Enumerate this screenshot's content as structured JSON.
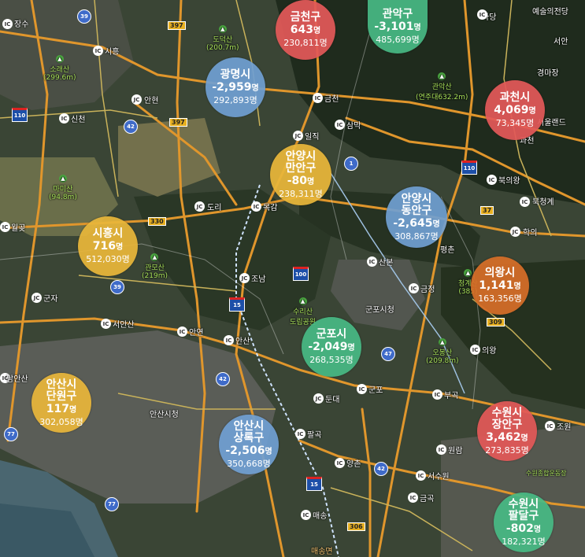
{
  "regions": [
    {
      "id": "geumcheon",
      "name1": "금천구",
      "name2": "",
      "change": "643",
      "change_suffix": "명",
      "population": "230,811명",
      "color": "red"
    },
    {
      "id": "gwanak",
      "name1": "관악구",
      "name2": "",
      "change": "-3,101",
      "change_suffix": "명",
      "population": "485,699명",
      "color": "green"
    },
    {
      "id": "gwangmyeong",
      "name1": "광명시",
      "name2": "",
      "change": "-2,959",
      "change_suffix": "명",
      "population": "292,893명",
      "color": "blue"
    },
    {
      "id": "gwacheon",
      "name1": "과천시",
      "name2": "",
      "change": "4,069",
      "change_suffix": "명",
      "population": "73,345명",
      "color": "red"
    },
    {
      "id": "anyang-manan",
      "name1": "안양시",
      "name2": "만안구",
      "change": "-80",
      "change_suffix": "명",
      "population": "238,311명",
      "color": "yellow"
    },
    {
      "id": "anyang-dongan",
      "name1": "안양시",
      "name2": "동안구",
      "change": "-2,645",
      "change_suffix": "명",
      "population": "308,867명",
      "color": "blue"
    },
    {
      "id": "siheung",
      "name1": "시흥시",
      "name2": "",
      "change": "716",
      "change_suffix": "명",
      "population": "512,030명",
      "color": "yellow"
    },
    {
      "id": "uiwang",
      "name1": "의왕시",
      "name2": "",
      "change": "1,141",
      "change_suffix": "명",
      "population": "163,356명",
      "color": "orange"
    },
    {
      "id": "gunpo",
      "name1": "군포시",
      "name2": "",
      "change": "-2,049",
      "change_suffix": "명",
      "population": "268,535명",
      "color": "green"
    },
    {
      "id": "ansan-danwon",
      "name1": "안산시",
      "name2": "단원구",
      "change": "117",
      "change_suffix": "명",
      "population": "302,058명",
      "color": "yellow"
    },
    {
      "id": "ansan-sangrok",
      "name1": "안산시",
      "name2": "상록구",
      "change": "-2,506",
      "change_suffix": "명",
      "population": "350,668명",
      "color": "blue"
    },
    {
      "id": "suwon-jangan",
      "name1": "수원시",
      "name2": "장안구",
      "change": "3,462",
      "change_suffix": "명",
      "population": "273,835명",
      "color": "red"
    },
    {
      "id": "suwon-paldal",
      "name1": "수원시",
      "name2": "팔달구",
      "change": "-802",
      "change_suffix": "명",
      "population": "182,321명",
      "color": "green"
    }
  ],
  "labels": {
    "jangsu": "장수",
    "siheung_ic": "시흥",
    "anhyeon": "안현",
    "sincheon": "신천",
    "geumcheon_ic": "금천",
    "samak": "삼막",
    "ilji": "일직",
    "seokam": "석암",
    "doeri": "도리",
    "mokgam": "목감",
    "joam": "조남",
    "hakui": "학의",
    "bukcheonggye": "북청계",
    "gwacheon_ic": "과천",
    "bugurui": "북의왕",
    "wolgot": "월곶",
    "gunja": "군자",
    "seoansan": "서안산",
    "anyeon": "안연",
    "ansan": "안산",
    "namansan": "남안산",
    "gunpo": "군포",
    "dundae": "둔대",
    "bugok": "부곡",
    "uiwang": "의왕",
    "paljang": "팔곡",
    "maesong": "매송",
    "yangchon": "양촌",
    "seosuwon": "서수원",
    "geumgok": "금곡",
    "wonram": "원람",
    "jowon": "조원",
    "sanbon": "산본",
    "pyeongchon": "평촌",
    "geumjeong": "금정",
    "gunposicheong": "군포시청",
    "ansansicheong": "안산시청",
    "sadang": "사당",
    "seoan": "서안",
    "yesuljeondang": "예술의전당",
    "hongeuntu": "송",
    "maesongmyeon": "매송면",
    "gwacheon_dong": "과천"
  },
  "mountains": [
    {
      "id": "dodeoksan",
      "name": "도덕산",
      "elev": "(200.7m)"
    },
    {
      "id": "sorae",
      "name": "소래산",
      "elev": "(299.6m)"
    },
    {
      "id": "gwanaksan",
      "name": "관악산",
      "elev": "(연주대632.2m)"
    },
    {
      "id": "magisan",
      "name": "마미산",
      "elev": "(94.8m)"
    },
    {
      "id": "gwanmosan",
      "name": "관모산",
      "elev": "(219m)"
    },
    {
      "id": "surisan",
      "name": "수리산",
      "elev": "도립공원"
    },
    {
      "id": "obongsan",
      "name": "오봉산",
      "elev": "(209.8m)"
    },
    {
      "id": "cheonggyesan",
      "name": "청계산",
      "elev": "(385)"
    }
  ],
  "pois": {
    "seoulland": "서울랜드",
    "gyeongmajang": "경마장",
    "suwonsports": "수원종합운동장"
  },
  "route_numbers": {
    "r397a": "397",
    "r397b": "397",
    "r330": "330",
    "r309": "309",
    "r306": "306",
    "r37": "37",
    "r39a": "39",
    "r39b": "39",
    "r42a": "42",
    "r42b": "42",
    "r42c": "42",
    "r47": "47",
    "r77a": "77",
    "r77b": "77",
    "r1": "1",
    "e110a": "110",
    "e110b": "110",
    "e100": "100",
    "e15a": "15",
    "e15b": "15"
  },
  "ic_badge": "IC",
  "jc_badge": "JC"
}
